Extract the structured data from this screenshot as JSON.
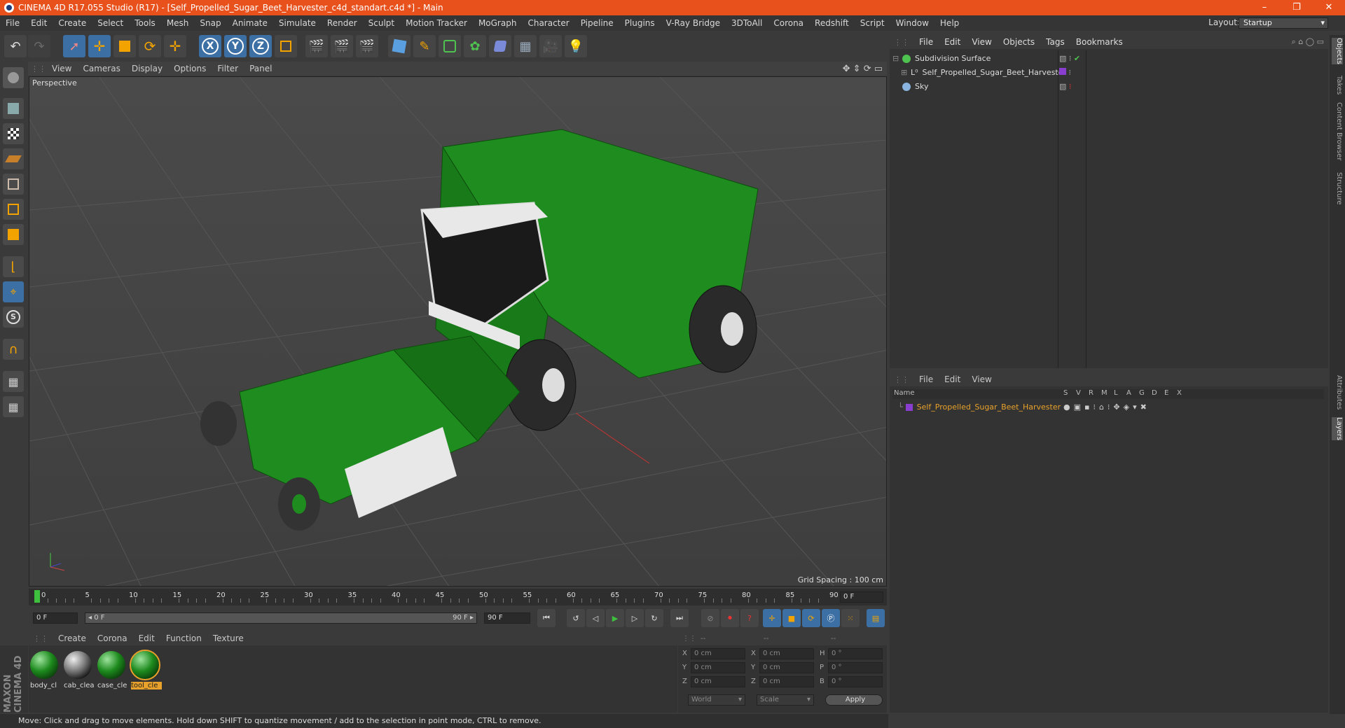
{
  "window": {
    "title": "CINEMA 4D R17.055 Studio (R17) - [Self_Propelled_Sugar_Beet_Harvester_c4d_standart.c4d *] - Main",
    "controls": [
      "–",
      "❐",
      "✕"
    ]
  },
  "menubar": [
    "File",
    "Edit",
    "Create",
    "Select",
    "Tools",
    "Mesh",
    "Snap",
    "Animate",
    "Simulate",
    "Render",
    "Sculpt",
    "Motion Tracker",
    "MoGraph",
    "Character",
    "Pipeline",
    "Plugins",
    "V-Ray Bridge",
    "3DToAll",
    "Corona",
    "Redshift",
    "Script",
    "Window",
    "Help"
  ],
  "layout": {
    "label": "Layout:",
    "value": "Startup"
  },
  "viewport": {
    "menu": [
      "View",
      "Cameras",
      "Display",
      "Options",
      "Filter",
      "Panel"
    ],
    "label": "Perspective",
    "grid_spacing": "Grid Spacing : 100 cm"
  },
  "toolbar": {
    "axis_x": "X",
    "axis_y": "Y",
    "axis_z": "Z"
  },
  "timeline": {
    "ticks": [
      "0",
      "5",
      "10",
      "15",
      "20",
      "25",
      "30",
      "35",
      "40",
      "45",
      "50",
      "55",
      "60",
      "65",
      "70",
      "75",
      "80",
      "85",
      "90"
    ],
    "frame_end_field": "0 F",
    "start_field": "0 F",
    "range_start": "◂ 0 F",
    "range_end": "90 F ▸",
    "end_field": "90 F"
  },
  "materials": {
    "menu": [
      "Create",
      "Corona",
      "Edit",
      "Function",
      "Texture"
    ],
    "items": [
      {
        "label": "body_cl"
      },
      {
        "label": "cab_clea"
      },
      {
        "label": "case_cle"
      },
      {
        "label": "tool_cle"
      }
    ],
    "brand": "MAXON CINEMA 4D"
  },
  "coords": {
    "headers": [
      "--",
      "--",
      "--"
    ],
    "rows": [
      {
        "a": "X",
        "av": "0 cm",
        "b": "X",
        "bv": "0 cm",
        "c": "H",
        "cv": "0 °"
      },
      {
        "a": "Y",
        "av": "0 cm",
        "b": "Y",
        "bv": "0 cm",
        "c": "P",
        "cv": "0 °"
      },
      {
        "a": "Z",
        "av": "0 cm",
        "b": "Z",
        "bv": "0 cm",
        "c": "B",
        "cv": "0 °"
      }
    ],
    "mode1": "World",
    "mode2": "Scale",
    "apply": "Apply"
  },
  "status": "Move: Click and drag to move elements. Hold down SHIFT to quantize movement / add to the selection in point mode, CTRL to remove.",
  "object_manager": {
    "menu": [
      "File",
      "Edit",
      "View",
      "Objects",
      "Tags",
      "Bookmarks"
    ],
    "objects": [
      "Subdivision Surface",
      "Self_Propelled_Sugar_Beet_Harvester",
      "Sky"
    ]
  },
  "layer_manager": {
    "menu": [
      "File",
      "Edit",
      "View"
    ],
    "columns": [
      "Name",
      "S",
      "V",
      "R",
      "M",
      "L",
      "A",
      "G",
      "D",
      "E",
      "X"
    ],
    "layers": [
      "Self_Propelled_Sugar_Beet_Harvester"
    ]
  },
  "right_tabs": [
    "Objects",
    "Takes",
    "Content Browser",
    "Structure",
    "Attributes",
    "Layers"
  ],
  "colors": {
    "title_bar": "#e8511c",
    "selection_blue": "#3c6fa3",
    "material_green": "#1d8a1d",
    "layer_highlight": "#e8a12a"
  }
}
